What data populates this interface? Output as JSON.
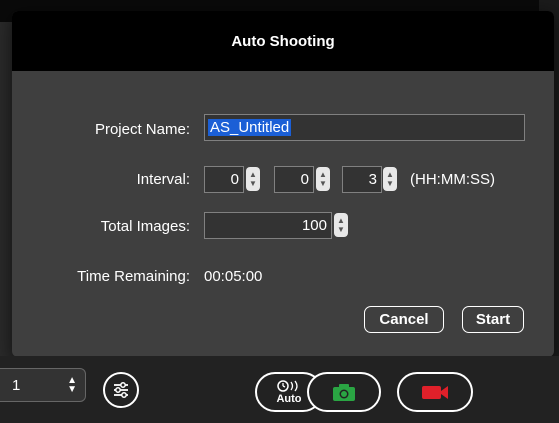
{
  "dialog": {
    "title": "Auto Shooting",
    "project_name_label": "Project Name:",
    "project_name_value": "AS_Untitled",
    "interval_label": "Interval:",
    "interval_hours": "0",
    "interval_minutes": "0",
    "interval_seconds": "3",
    "interval_format": "(HH:MM:SS)",
    "total_images_label": "Total Images:",
    "total_images_value": "100",
    "time_remaining_label": "Time Remaining:",
    "time_remaining_value": "00:05:00",
    "cancel_label": "Cancel",
    "start_label": "Start"
  },
  "toolbar": {
    "camera_index": "1",
    "auto_label": "Auto"
  },
  "colors": {
    "accent_green": "#2aa543",
    "record_red": "#e0202a",
    "selection_blue": "#1b5fd6"
  }
}
